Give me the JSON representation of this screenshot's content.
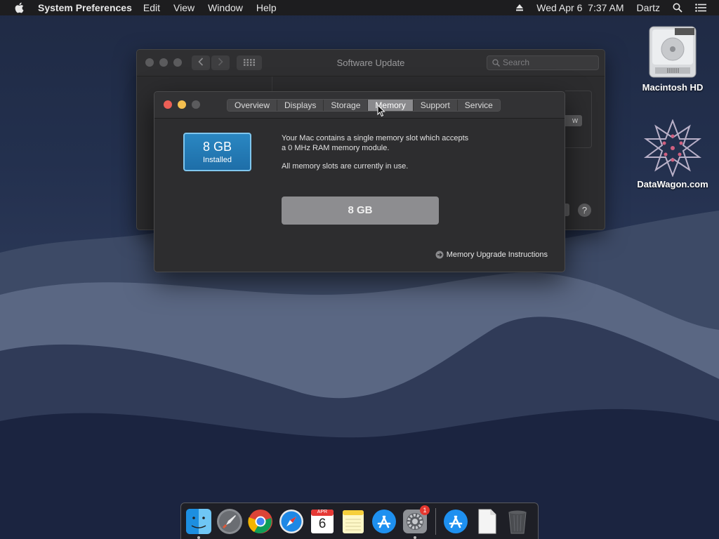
{
  "menubar": {
    "app_name": "System Preferences",
    "items": [
      "Edit",
      "View",
      "Window",
      "Help"
    ],
    "datetime": "Wed Apr 6  7:37 AM",
    "user": "Dartz"
  },
  "desktop": {
    "icons": [
      {
        "label": "Macintosh HD",
        "icon": "hard-drive-icon"
      },
      {
        "label": "DataWagon.com",
        "icon": "star-emblem-icon"
      }
    ]
  },
  "back_window": {
    "title": "Software Update",
    "search_placeholder": "Search",
    "partial_button": "w"
  },
  "front_window": {
    "tabs": [
      "Overview",
      "Displays",
      "Storage",
      "Memory",
      "Support",
      "Service"
    ],
    "active_tab": "Memory",
    "memory_size": "8 GB",
    "memory_status": "Installed",
    "description_line1": "Your Mac contains a single memory slot which accepts",
    "description_line2": "a 0 MHz RAM memory module.",
    "slots_note": "All memory slots are currently in use.",
    "slot_label": "8 GB",
    "upgrade_link": "Memory Upgrade Instructions"
  },
  "dock": {
    "items": [
      "Finder",
      "Launchpad",
      "Chrome",
      "Safari",
      "Calendar",
      "Notes",
      "App Store",
      "System Preferences",
      "App Store",
      "Document",
      "Trash"
    ],
    "calendar_month": "APR",
    "calendar_day": "6",
    "prefs_badge": "1"
  },
  "colors": {
    "accent": "#2a87c2",
    "close": "#ec5f56",
    "minimize": "#f4bf4f",
    "zoom_disabled": "#5b5b5d"
  }
}
